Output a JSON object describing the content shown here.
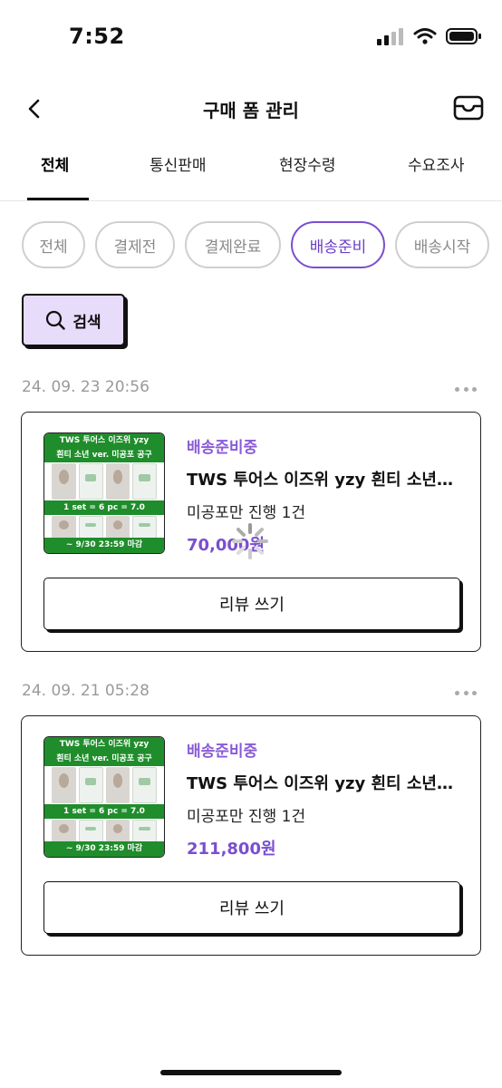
{
  "status_bar": {
    "time": "7:52",
    "icons": [
      "cellular-signal-icon",
      "wifi-icon",
      "battery-icon"
    ]
  },
  "header": {
    "title": "구매 폼 관리",
    "back_icon": "chevron-left-icon",
    "inbox_icon": "inbox-icon"
  },
  "tabs": [
    {
      "label": "전체",
      "active": true
    },
    {
      "label": "통신판매",
      "active": false
    },
    {
      "label": "현장수령",
      "active": false
    },
    {
      "label": "수요조사",
      "active": false
    }
  ],
  "filters": [
    {
      "label": "전체",
      "active": false
    },
    {
      "label": "결제전",
      "active": false
    },
    {
      "label": "결제완료",
      "active": false
    },
    {
      "label": "배송준비",
      "active": true
    },
    {
      "label": "배송시작",
      "active": false
    }
  ],
  "search": {
    "label": "검색",
    "icon": "search-icon"
  },
  "orders": [
    {
      "date": "24. 09. 23 20:56",
      "thumbnail": {
        "line1": "TWS 투어스 이즈위 yzy",
        "line2": "흰티 소년 ver. 미공포 공구",
        "line3": "1 set = 6 pc = 7.0",
        "line4": "~ 9/30 23:59 마감"
      },
      "status": "배송준비중",
      "product_name": "TWS 투어스 이즈위 yzy 흰티 소년 ...",
      "option": "미공포만 진행 1건",
      "price": "70,000원",
      "review_label": "리뷰 쓰기",
      "loading": true
    },
    {
      "date": "24. 09. 21 05:28",
      "thumbnail": {
        "line1": "TWS 투어스 이즈위 yzy",
        "line2": "흰티 소년 ver. 미공포 공구",
        "line3": "1 set = 6 pc = 7.0",
        "line4": "~ 9/30 23:59 마감"
      },
      "status": "배송준비중",
      "product_name": "TWS 투어스 이즈위 yzy 흰티 소년 ...",
      "option": "미공포만 진행 1건",
      "price": "211,800원",
      "review_label": "리뷰 쓰기",
      "loading": false
    }
  ],
  "colors": {
    "accent_purple": "#7a4fd0",
    "status_purple": "#8a5bd6",
    "search_bg": "#e8dcfb",
    "thumb_green": "#1f8d2b",
    "date_gray": "#9a9a9a"
  }
}
